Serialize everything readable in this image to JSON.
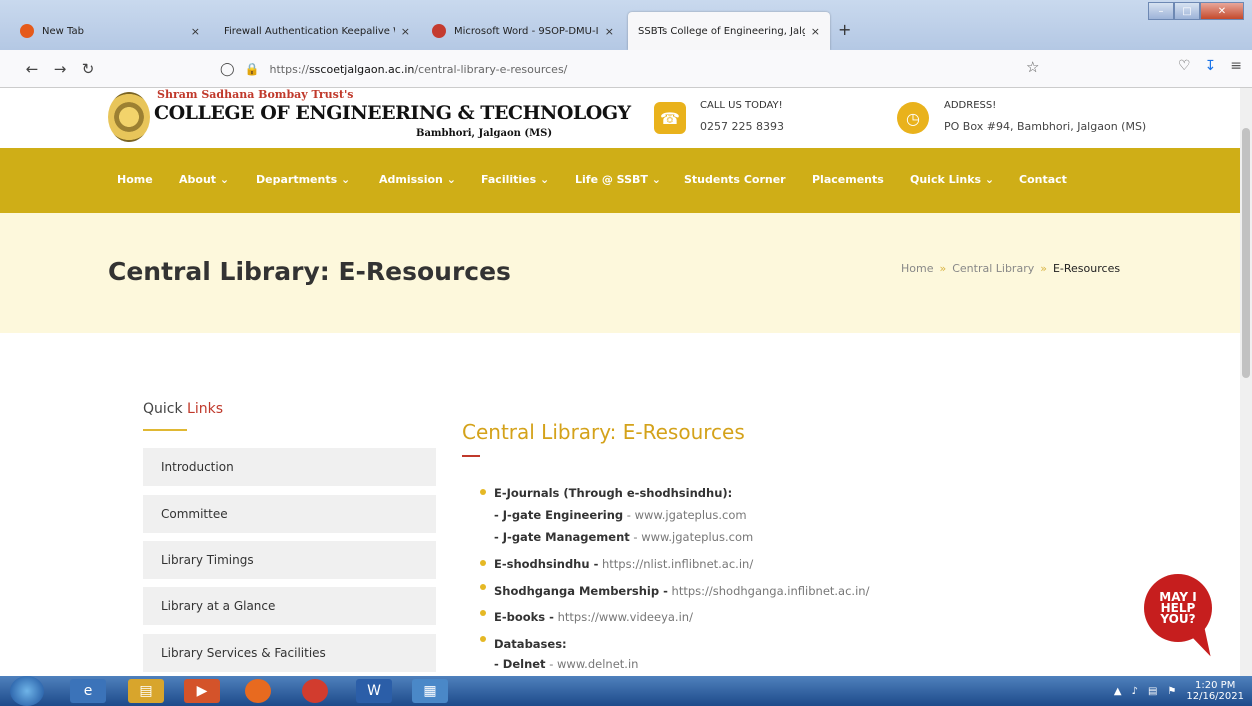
{
  "browser": {
    "tabs": [
      {
        "title": "New Tab",
        "close": "×",
        "color": "#e55a1a"
      },
      {
        "title": "Firewall Authentication Keepalive W",
        "close": "×",
        "color": ""
      },
      {
        "title": "Microsoft Word - 9SOP-DMU-I",
        "close": "×",
        "color": "#c43b2f"
      },
      {
        "title": "SSBTs College of Engineering, Jalga",
        "close": "×",
        "color": ""
      }
    ],
    "new_tab": "+",
    "url_scheme": "https://",
    "url_host": "sscoetjalgaon.ac.in",
    "url_path": "/central-library-e-resources/"
  },
  "header": {
    "trust": "Shram Sadhana Bombay Trust's",
    "college": "COLLEGE OF ENGINEERING & TECHNOLOGY",
    "place": "Bambhori, Jalgaon (MS)",
    "call_label": "CALL US TODAY!",
    "call_value": "0257 225 8393",
    "address_label": "ADDRESS!",
    "address_value": "PO Box #94, Bambhori, Jalgaon (MS)"
  },
  "menu": [
    "Home",
    "About ⌄",
    "Departments ⌄",
    "Admission ⌄",
    "Facilities ⌄",
    "Life @ SSBT ⌄",
    "Students Corner",
    "Placements",
    "Quick Links ⌄",
    "Contact"
  ],
  "page": {
    "title": "Central Library: E-Resources",
    "breadcrumb": [
      "Home",
      "Central Library",
      "E-Resources"
    ],
    "breadcrumb_sep": "»"
  },
  "sidebar": {
    "title_a": "Quick ",
    "title_b": "Links",
    "items": [
      "Introduction",
      "Committee",
      "Library Timings",
      "Library at a Glance",
      "Library Services & Facilities"
    ]
  },
  "content": {
    "title": "Central Library: E-Resources",
    "ejournals": "E-Journals (Through e-shodhsindhu):",
    "jgate_eng_label": "- J-gate Engineering",
    "jgate_eng_url": " - www.jgateplus.com",
    "jgate_mgmt_label": "- J-gate Management",
    "jgate_mgmt_url": " - www.jgateplus.com",
    "eshodh_label": "E-shodhsindhu -",
    "eshodh_url": " https://nlist.inflibnet.ac.in/",
    "shodhganga_label": "Shodhganga Membership -",
    "shodhganga_url": " https://shodhganga.inflibnet.ac.in/",
    "ebooks_label": "E-books -",
    "ebooks_url": " https://www.videeya.in/",
    "databases": "Databases:",
    "delnet_label": "- Delnet",
    "delnet_url": " - www.delnet.in"
  },
  "help": {
    "line1": "MAY I",
    "line2": "HELP",
    "line3": "YOU?"
  },
  "taskbar": {
    "time": "1:20 PM",
    "date": "12/16/2021"
  },
  "colors": {
    "accent": "#cfae17",
    "title_band": "#fdf8dc",
    "brand_red": "#c0392b"
  }
}
